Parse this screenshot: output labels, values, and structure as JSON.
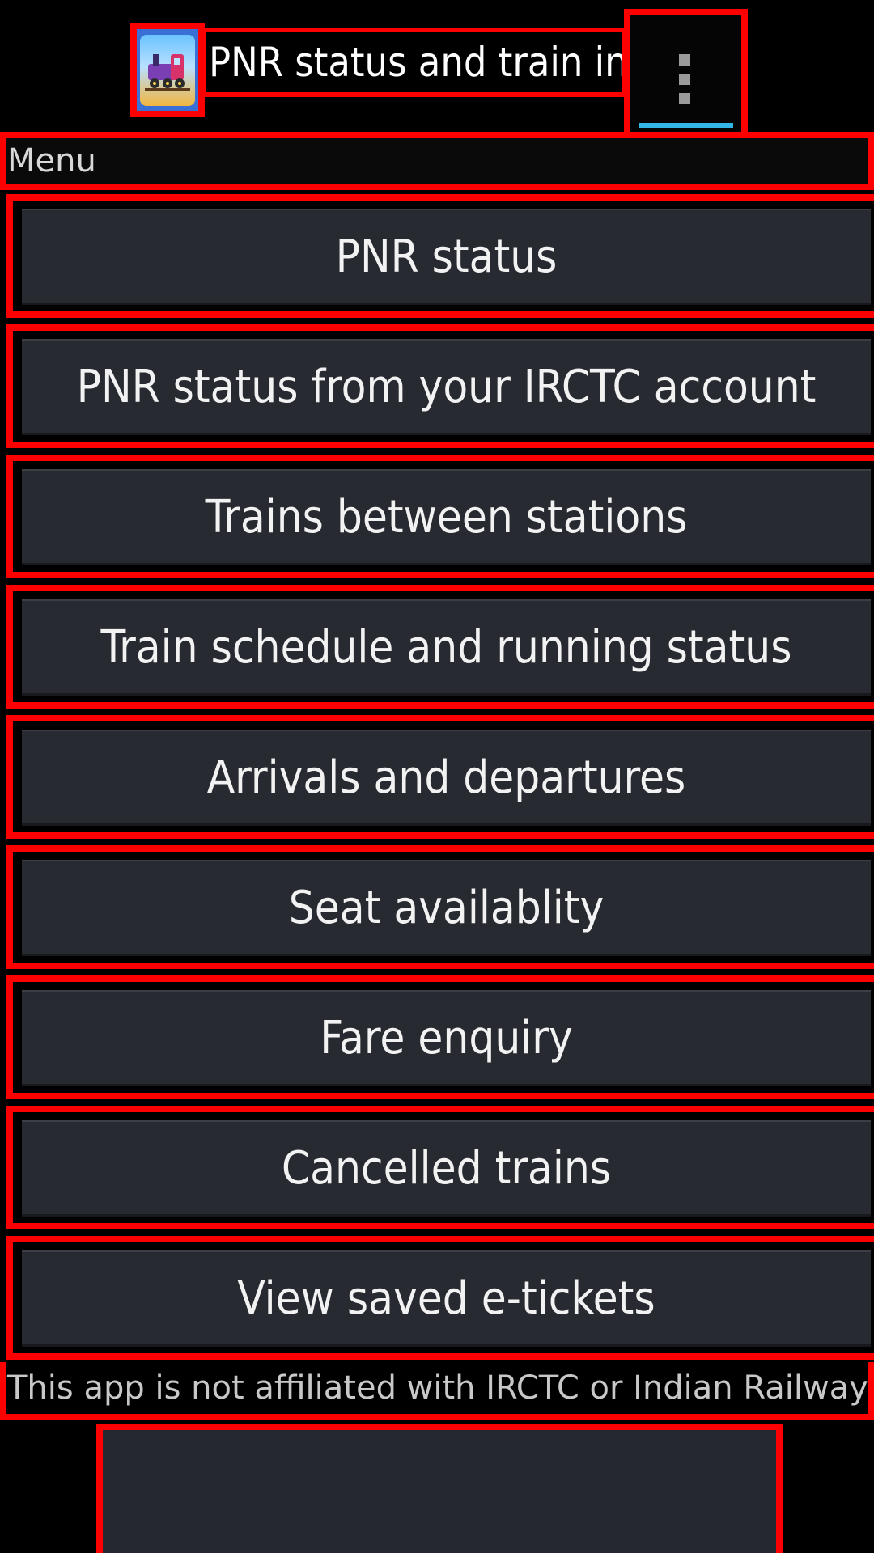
{
  "app_bar": {
    "title": "PNR status and train info",
    "icon": "train-icon",
    "overflow_icon": "overflow-menu-icon"
  },
  "menu": {
    "label": "Menu",
    "items": [
      {
        "label": "PNR status"
      },
      {
        "label": "PNR status from your IRCTC account"
      },
      {
        "label": "Trains between stations"
      },
      {
        "label": "Train schedule and running status"
      },
      {
        "label": "Arrivals and departures"
      },
      {
        "label": "Seat availablity"
      },
      {
        "label": "Fare enquiry"
      },
      {
        "label": "Cancelled trains"
      },
      {
        "label": "View saved e-tickets"
      }
    ]
  },
  "disclaimer": "This app is not affiliated with IRCTC or Indian Railways.",
  "colors": {
    "background": "#000000",
    "button": "#272a30",
    "accent": "#33b5e5",
    "highlight": "#ff0000"
  }
}
